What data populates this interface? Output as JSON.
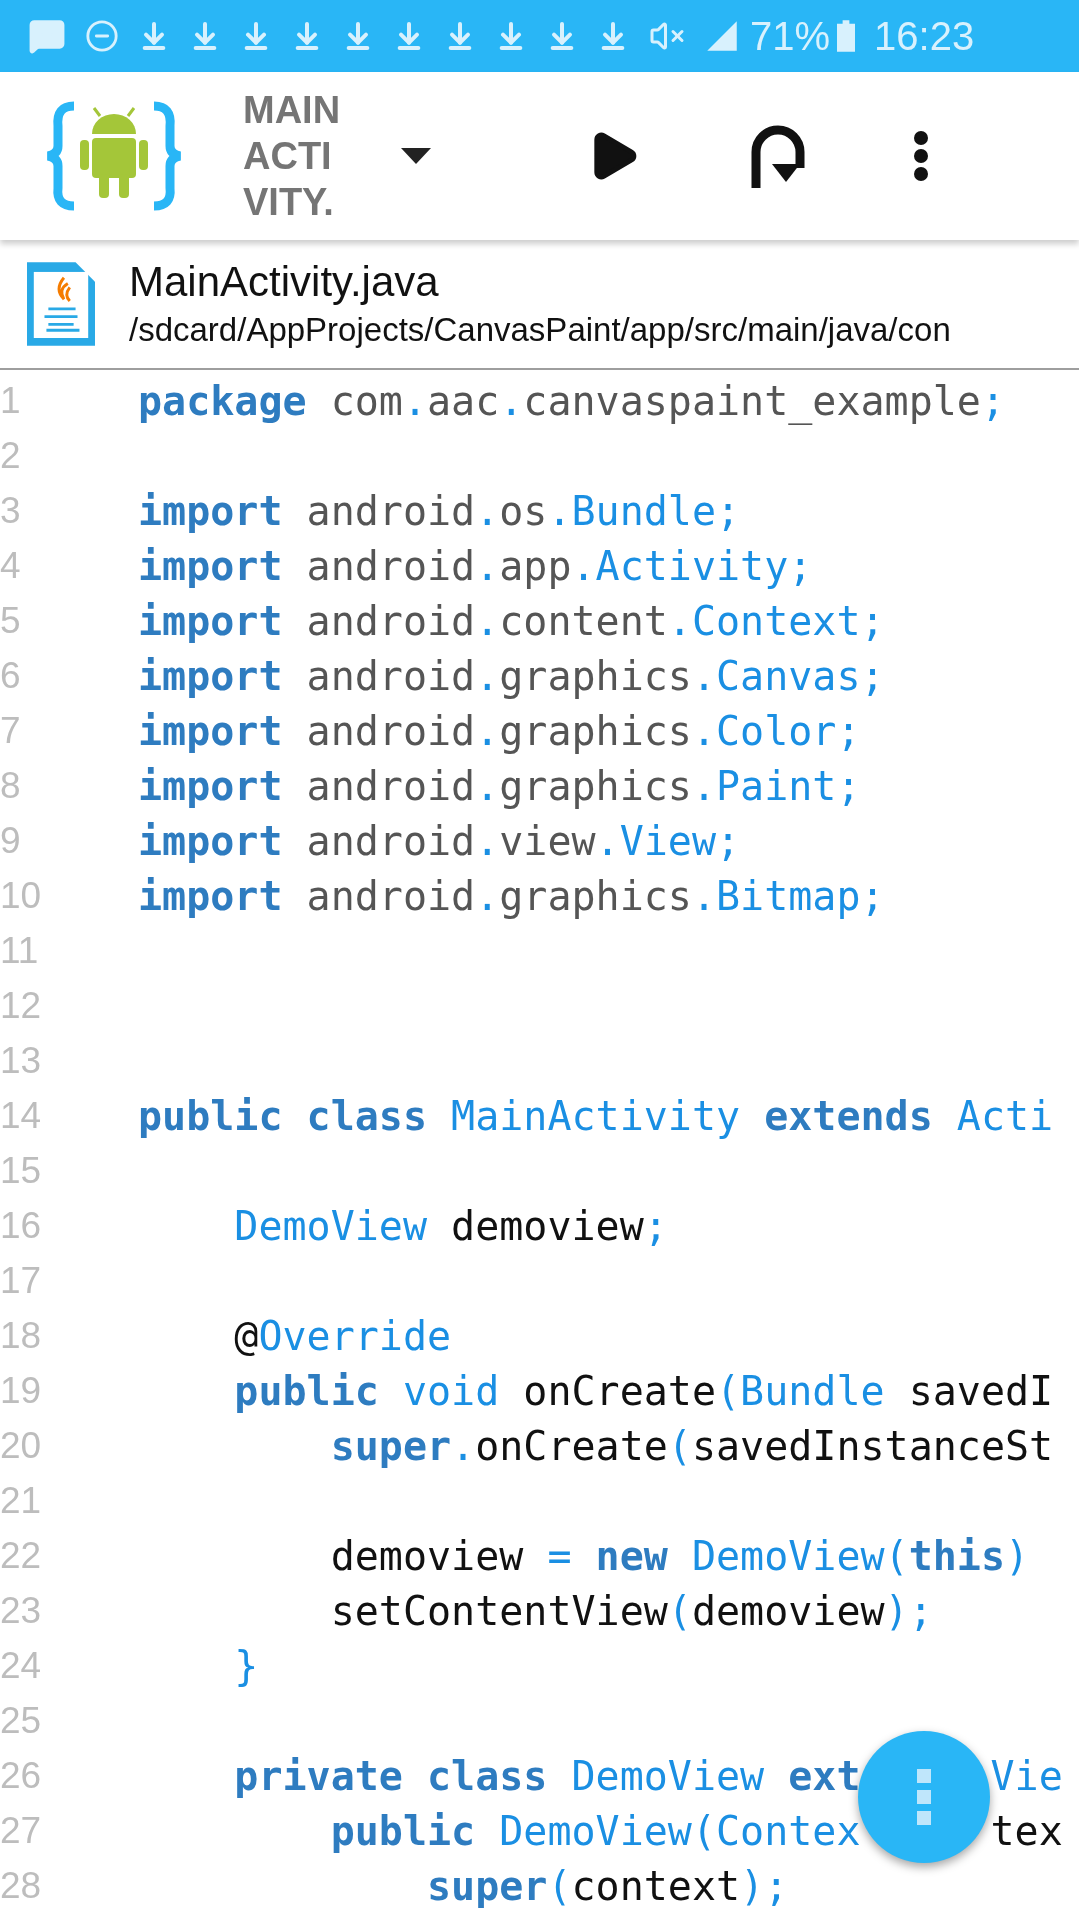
{
  "status_bar": {
    "icons": [
      {
        "kind": "message"
      },
      {
        "kind": "dnd"
      },
      {
        "kind": "download"
      },
      {
        "kind": "download"
      },
      {
        "kind": "download"
      },
      {
        "kind": "download"
      },
      {
        "kind": "download"
      },
      {
        "kind": "download"
      },
      {
        "kind": "download"
      },
      {
        "kind": "download"
      },
      {
        "kind": "download"
      },
      {
        "kind": "download"
      },
      {
        "kind": "vibrate"
      },
      {
        "kind": "signal"
      }
    ],
    "battery": "71%",
    "time": "16:23"
  },
  "toolbar": {
    "title_lines": [
      "MAIN",
      "ACTI",
      "VITY."
    ]
  },
  "file": {
    "name": "MainActivity.java",
    "path": "/sdcard/AppProjects/CanvasPaint/app/src/main/java/con"
  },
  "editor": {
    "lines": [
      {
        "number": "1",
        "tokens": [
          {
            "kind": "keyword",
            "text": "package"
          },
          {
            "kind": "ident",
            "text": " com"
          },
          {
            "kind": "punct",
            "text": "."
          },
          {
            "kind": "ident",
            "text": "aac"
          },
          {
            "kind": "punct",
            "text": "."
          },
          {
            "kind": "ident",
            "text": "canvaspaint_example"
          },
          {
            "kind": "punct",
            "text": ";"
          }
        ]
      },
      {
        "number": "2"
      },
      {
        "number": "3",
        "tokens": [
          {
            "kind": "keyword",
            "text": "import"
          },
          {
            "kind": "ident",
            "text": " android"
          },
          {
            "kind": "punct",
            "text": "."
          },
          {
            "kind": "ident",
            "text": "os"
          },
          {
            "kind": "punct",
            "text": "."
          },
          {
            "kind": "type",
            "text": "Bundle"
          },
          {
            "kind": "punct",
            "text": ";"
          }
        ]
      },
      {
        "number": "4",
        "tokens": [
          {
            "kind": "keyword",
            "text": "import"
          },
          {
            "kind": "ident",
            "text": " android"
          },
          {
            "kind": "punct",
            "text": "."
          },
          {
            "kind": "ident",
            "text": "app"
          },
          {
            "kind": "punct",
            "text": "."
          },
          {
            "kind": "type",
            "text": "Activity"
          },
          {
            "kind": "punct",
            "text": ";"
          }
        ]
      },
      {
        "number": "5",
        "tokens": [
          {
            "kind": "keyword",
            "text": "import"
          },
          {
            "kind": "ident",
            "text": " android"
          },
          {
            "kind": "punct",
            "text": "."
          },
          {
            "kind": "ident",
            "text": "content"
          },
          {
            "kind": "punct",
            "text": "."
          },
          {
            "kind": "type",
            "text": "Context"
          },
          {
            "kind": "punct",
            "text": ";"
          }
        ]
      },
      {
        "number": "6",
        "tokens": [
          {
            "kind": "keyword",
            "text": "import"
          },
          {
            "kind": "ident",
            "text": " android"
          },
          {
            "kind": "punct",
            "text": "."
          },
          {
            "kind": "ident",
            "text": "graphics"
          },
          {
            "kind": "punct",
            "text": "."
          },
          {
            "kind": "type",
            "text": "Canvas"
          },
          {
            "kind": "punct",
            "text": ";"
          }
        ]
      },
      {
        "number": "7",
        "tokens": [
          {
            "kind": "keyword",
            "text": "import"
          },
          {
            "kind": "ident",
            "text": " android"
          },
          {
            "kind": "punct",
            "text": "."
          },
          {
            "kind": "ident",
            "text": "graphics"
          },
          {
            "kind": "punct",
            "text": "."
          },
          {
            "kind": "type",
            "text": "Color"
          },
          {
            "kind": "punct",
            "text": ";"
          }
        ]
      },
      {
        "number": "8",
        "tokens": [
          {
            "kind": "keyword",
            "text": "import"
          },
          {
            "kind": "ident",
            "text": " android"
          },
          {
            "kind": "punct",
            "text": "."
          },
          {
            "kind": "ident",
            "text": "graphics"
          },
          {
            "kind": "punct",
            "text": "."
          },
          {
            "kind": "type",
            "text": "Paint"
          },
          {
            "kind": "punct",
            "text": ";"
          }
        ]
      },
      {
        "number": "9",
        "tokens": [
          {
            "kind": "keyword",
            "text": "import"
          },
          {
            "kind": "ident",
            "text": " android"
          },
          {
            "kind": "punct",
            "text": "."
          },
          {
            "kind": "ident",
            "text": "view"
          },
          {
            "kind": "punct",
            "text": "."
          },
          {
            "kind": "type",
            "text": "View"
          },
          {
            "kind": "punct",
            "text": ";"
          }
        ]
      },
      {
        "number": "10",
        "tokens": [
          {
            "kind": "keyword",
            "text": "import"
          },
          {
            "kind": "ident",
            "text": " android"
          },
          {
            "kind": "punct",
            "text": "."
          },
          {
            "kind": "ident",
            "text": "graphics"
          },
          {
            "kind": "punct",
            "text": "."
          },
          {
            "kind": "type",
            "text": "Bitmap"
          },
          {
            "kind": "punct",
            "text": ";"
          }
        ]
      },
      {
        "number": "11"
      },
      {
        "number": "12"
      },
      {
        "number": "13"
      },
      {
        "number": "14",
        "tokens": [
          {
            "kind": "keyword",
            "text": "public class"
          },
          {
            "kind": "type",
            "text": " MainActivity"
          },
          {
            "kind": "keyword",
            "text": " extends"
          },
          {
            "kind": "type",
            "text": " Acti"
          }
        ]
      },
      {
        "number": "15"
      },
      {
        "number": "16",
        "tokens": [
          {
            "kind": "type",
            "text": "    DemoView"
          },
          {
            "kind": "text",
            "text": " demoview"
          },
          {
            "kind": "punct",
            "text": ";"
          }
        ]
      },
      {
        "number": "17"
      },
      {
        "number": "18",
        "tokens": [
          {
            "kind": "text",
            "text": "    @"
          },
          {
            "kind": "type",
            "text": "Override"
          }
        ]
      },
      {
        "number": "19",
        "tokens": [
          {
            "kind": "keyword",
            "text": "    public"
          },
          {
            "kind": "type",
            "text": " void"
          },
          {
            "kind": "text",
            "text": " onCreate"
          },
          {
            "kind": "punct",
            "text": "("
          },
          {
            "kind": "type",
            "text": "Bundle"
          },
          {
            "kind": "text",
            "text": " savedI"
          }
        ]
      },
      {
        "number": "20",
        "tokens": [
          {
            "kind": "keyword",
            "text": "        super"
          },
          {
            "kind": "punct",
            "text": "."
          },
          {
            "kind": "text",
            "text": "onCreate"
          },
          {
            "kind": "punct",
            "text": "("
          },
          {
            "kind": "text",
            "text": "savedInstanceSt"
          }
        ]
      },
      {
        "number": "21"
      },
      {
        "number": "22",
        "tokens": [
          {
            "kind": "text",
            "text": "        demoview"
          },
          {
            "kind": "punct",
            "text": " ="
          },
          {
            "kind": "keyword",
            "text": " new"
          },
          {
            "kind": "type",
            "text": " DemoView"
          },
          {
            "kind": "punct",
            "text": "("
          },
          {
            "kind": "keyword",
            "text": "this"
          },
          {
            "kind": "punct",
            "text": ")"
          }
        ]
      },
      {
        "number": "23",
        "tokens": [
          {
            "kind": "text",
            "text": "        setContentView"
          },
          {
            "kind": "punct",
            "text": "("
          },
          {
            "kind": "text",
            "text": "demoview"
          },
          {
            "kind": "punct",
            "text": ");"
          }
        ]
      },
      {
        "number": "24",
        "tokens": [
          {
            "kind": "punct",
            "text": "    }"
          }
        ]
      },
      {
        "number": "25"
      },
      {
        "number": "26",
        "tokens": [
          {
            "kind": "keyword",
            "text": "    private class"
          },
          {
            "kind": "type",
            "text": " DemoView"
          },
          {
            "kind": "keyword",
            "text": " ext"
          },
          {
            "kind": "gap"
          },
          {
            "kind": "type",
            "text": "Vie"
          }
        ]
      },
      {
        "number": "27",
        "tokens": [
          {
            "kind": "keyword",
            "text": "        public"
          },
          {
            "kind": "type",
            "text": " DemoView"
          },
          {
            "kind": "punct",
            "text": "("
          },
          {
            "kind": "type",
            "text": "Contex"
          },
          {
            "kind": "gap"
          },
          {
            "kind": "text",
            "text": "tex"
          }
        ]
      },
      {
        "number": "28",
        "tokens": [
          {
            "kind": "keyword",
            "text": "            super"
          },
          {
            "kind": "punct",
            "text": "("
          },
          {
            "kind": "text",
            "text": "context"
          },
          {
            "kind": "punct",
            "text": ");"
          }
        ]
      }
    ]
  }
}
